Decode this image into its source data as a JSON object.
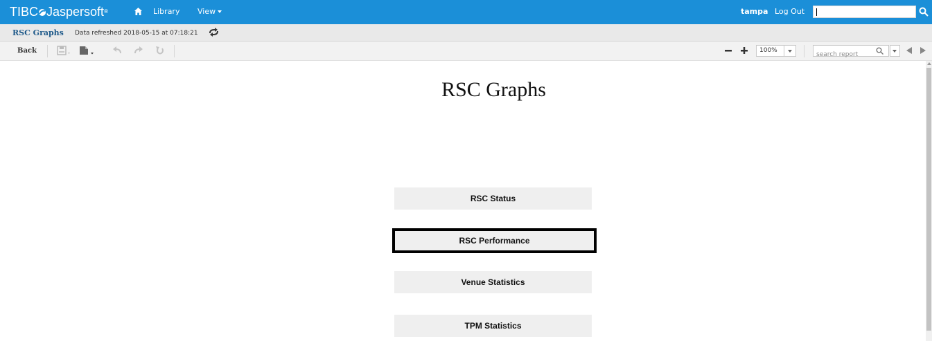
{
  "header": {
    "brand": "TIBC",
    "brand_rest": "Jaspersoft",
    "brand_reg": "®",
    "nav": {
      "library": "Library",
      "view": "View"
    },
    "user": "tampa",
    "logout": "Log Out"
  },
  "titlebar": {
    "report_title": "RSC Graphs",
    "refresh_info": "Data refreshed 2018-05-15 at 07:18:21"
  },
  "toolbar": {
    "back": "Back",
    "zoom_value": "100%",
    "search_placeholder": "search report"
  },
  "report": {
    "title": "RSC Graphs",
    "buttons": [
      {
        "label": "RSC Status"
      },
      {
        "label": "RSC Performance"
      },
      {
        "label": "Venue Statistics"
      },
      {
        "label": "TPM Statistics"
      }
    ]
  },
  "colors": {
    "header_bg": "#1b8fd8",
    "title_text": "#1f5a8a",
    "selected_border": "#000000"
  }
}
